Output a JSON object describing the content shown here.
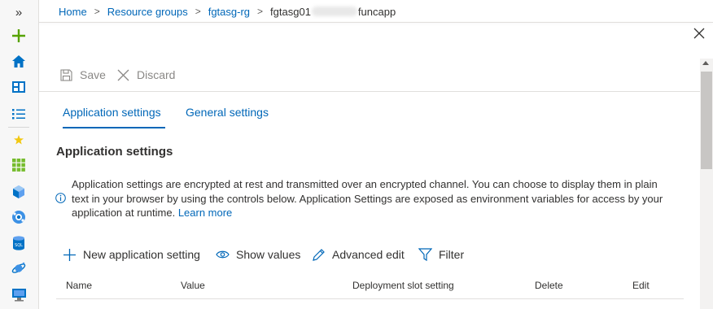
{
  "breadcrumb": {
    "items": [
      "Home",
      "Resource groups",
      "fgtasg-rg"
    ],
    "current_prefix": "fgtasg01",
    "current_suffix": "funcapp",
    "separator": ">"
  },
  "rail": {
    "collapse": "»",
    "icons": [
      "create-icon",
      "home-icon",
      "dashboard-icon",
      "all-services-icon",
      "favorites-star-icon",
      "all-resources-icon",
      "resource-groups-icon",
      "app-services-icon",
      "sql-databases-icon",
      "cosmos-db-icon",
      "virtual-machines-icon"
    ]
  },
  "commands": {
    "save": "Save",
    "discard": "Discard"
  },
  "tabs": [
    {
      "label": "Application settings",
      "active": true
    },
    {
      "label": "General settings",
      "active": false
    }
  ],
  "section": {
    "title": "Application settings",
    "info_text": "Application settings are encrypted at rest and transmitted over an encrypted channel. You can choose to display them in plain text in your browser by using the controls below. Application Settings are exposed as environment variables for access by your application at runtime.",
    "learn_more": "Learn more"
  },
  "actions": {
    "new": "New application setting",
    "show": "Show values",
    "advanced": "Advanced edit",
    "filter": "Filter"
  },
  "table": {
    "columns": [
      "Name",
      "Value",
      "Deployment slot setting",
      "Delete",
      "Edit"
    ]
  },
  "colors": {
    "accent": "#0067b8",
    "rail_green": "#57a300",
    "rail_blue": "#0072c6",
    "star": "#f2c811"
  }
}
